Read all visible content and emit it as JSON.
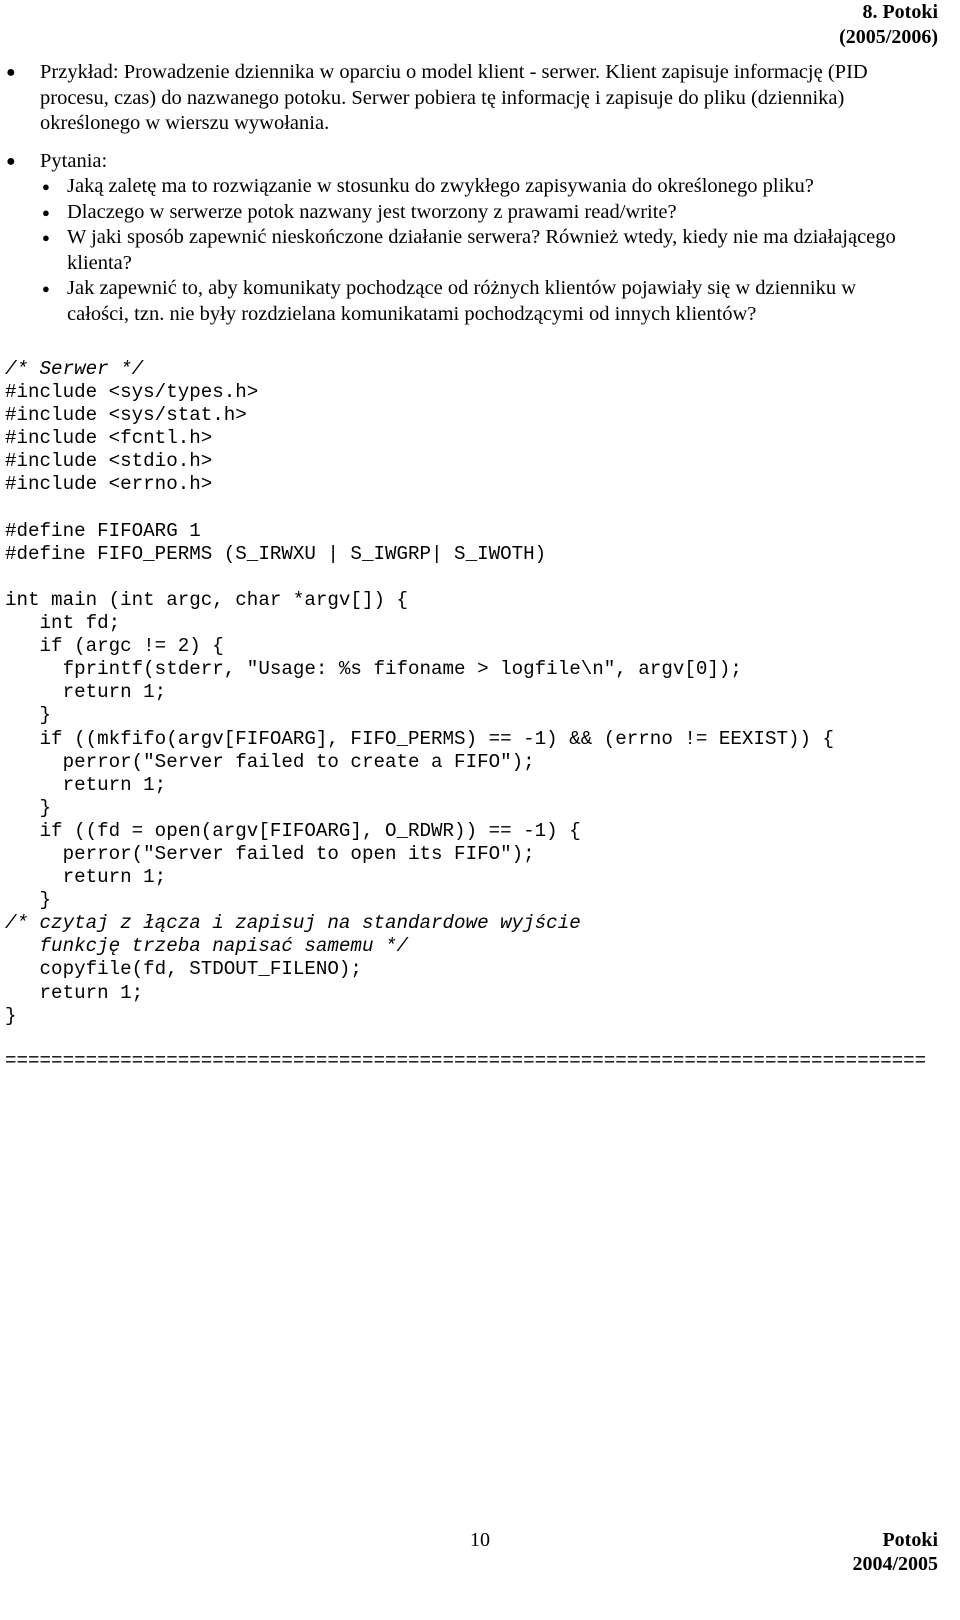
{
  "header": {
    "title": "8. Potoki",
    "subtitle": "(2005/2006)"
  },
  "body": {
    "bullets": [
      {
        "level": 1,
        "marker": "●",
        "text": "Przykład: Prowadzenie dziennika w oparciu o model klient - serwer. Klient zapisuje informację (PID procesu, czas) do nazwanego potoku. Serwer pobiera tę informację i zapisuje do pliku (dziennika) określonego w wierszu wywołania."
      },
      {
        "level": 1,
        "marker": "●",
        "text": "Pytania:"
      },
      {
        "level": 2,
        "marker": "●",
        "text": "Jaką zaletę ma to rozwiązanie w stosunku do zwykłego zapisywania do określonego pliku?"
      },
      {
        "level": 2,
        "marker": "●",
        "text": "Dlaczego w serwerze potok nazwany jest tworzony z prawami read/write?"
      },
      {
        "level": 2,
        "marker": "●",
        "text": "W jaki sposób zapewnić nieskończone działanie serwera? Również wtedy, kiedy nie ma działającego klienta?"
      },
      {
        "level": 2,
        "marker": "●",
        "text": "Jak zapewnić to, aby komunikaty pochodzące od różnych klientów pojawiały się w dzienniku w całości, tzn. nie były rozdzielana komunikatami pochodzącymi od innych klientów?"
      }
    ]
  },
  "code": {
    "lines": [
      {
        "text": "/* Serwer */",
        "italic": true
      },
      {
        "text": "#include <sys/types.h>",
        "italic": false
      },
      {
        "text": "#include <sys/stat.h>",
        "italic": false
      },
      {
        "text": "#include <fcntl.h>",
        "italic": false
      },
      {
        "text": "#include <stdio.h>",
        "italic": false
      },
      {
        "text": "#include <errno.h>",
        "italic": false
      },
      {
        "text": "",
        "italic": false
      },
      {
        "text": "#define FIFOARG 1",
        "italic": false
      },
      {
        "text": "#define FIFO_PERMS (S_IRWXU | S_IWGRP| S_IWOTH)",
        "italic": false
      },
      {
        "text": "",
        "italic": false
      },
      {
        "text": "int main (int argc, char *argv[]) {",
        "italic": false
      },
      {
        "text": "   int fd;",
        "italic": false
      },
      {
        "text": "   if (argc != 2) {",
        "italic": false
      },
      {
        "text": "     fprintf(stderr, \"Usage: %s fifoname > logfile\\n\", argv[0]);",
        "italic": false
      },
      {
        "text": "     return 1;",
        "italic": false
      },
      {
        "text": "   }",
        "italic": false
      },
      {
        "text": "   if ((mkfifo(argv[FIFOARG], FIFO_PERMS) == -1) && (errno != EEXIST)) {",
        "italic": false
      },
      {
        "text": "     perror(\"Server failed to create a FIFO\");",
        "italic": false
      },
      {
        "text": "     return 1;",
        "italic": false
      },
      {
        "text": "   }",
        "italic": false
      },
      {
        "text": "   if ((fd = open(argv[FIFOARG], O_RDWR)) == -1) {",
        "italic": false
      },
      {
        "text": "     perror(\"Server failed to open its FIFO\");",
        "italic": false
      },
      {
        "text": "     return 1;",
        "italic": false
      },
      {
        "text": "   }",
        "italic": false
      },
      {
        "text": "/* czytaj z łącza i zapisuj na standardowe wyjście",
        "italic": true
      },
      {
        "text": "   funkcję trzeba napisać samemu */",
        "italic": true
      },
      {
        "text": "   copyfile(fd, STDOUT_FILENO);",
        "italic": false
      },
      {
        "text": "   return 1;",
        "italic": false
      },
      {
        "text": "}",
        "italic": false
      }
    ],
    "separator": "================================================================================"
  },
  "footer": {
    "page_number": "10",
    "course": "Potoki",
    "year": "2004/2005"
  }
}
